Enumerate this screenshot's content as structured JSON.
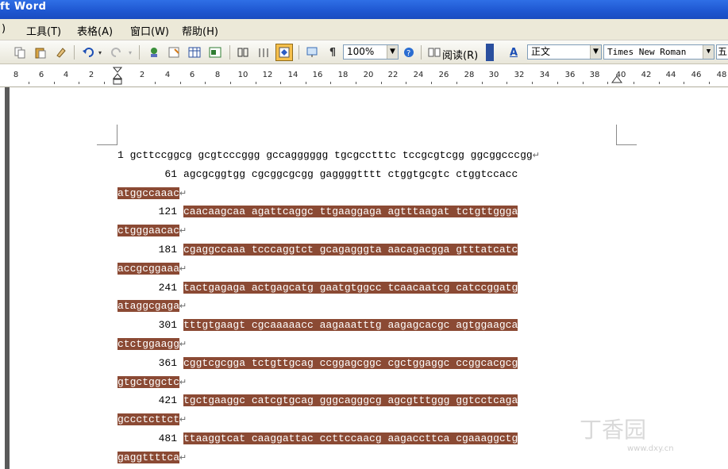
{
  "window": {
    "title": "ft Word"
  },
  "menu": [
    {
      "key": "partial",
      "label": ")"
    },
    {
      "key": "tools",
      "label": "工具(T)"
    },
    {
      "key": "table",
      "label": "表格(A)"
    },
    {
      "key": "window",
      "label": "窗口(W)"
    },
    {
      "key": "help",
      "label": "帮助(H)"
    }
  ],
  "toolbar": {
    "zoom": "100%",
    "read_label": "阅读(R)",
    "style": "正文",
    "font": "Times New Roman",
    "size_partial": "五",
    "icons": [
      "copy-icon",
      "paste-icon",
      "format-painter-icon",
      "undo-icon",
      "redo-icon",
      "hyperlink-icon",
      "tables-borders-icon",
      "insert-table-icon",
      "insert-excel-icon",
      "columns-icon",
      "drawing-icon",
      "document-map-icon",
      "show-hide-icon",
      "help-icon",
      "read-icon",
      "styles-icon"
    ]
  },
  "ruler": {
    "labels": [
      "8",
      "6",
      "4",
      "2",
      "2",
      "4",
      "6",
      "8",
      "10",
      "12",
      "14",
      "16",
      "18",
      "20",
      "22",
      "24",
      "26",
      "28",
      "30",
      "32",
      "34",
      "36",
      "38",
      "40",
      "42",
      "44",
      "46",
      "48"
    ]
  },
  "document": {
    "lines": [
      {
        "text": "1 gcttccggcg gcgtcccggg gccagggggg tgcgcctttc tccgcgtcgg ggcggcccgg",
        "pilcrow": "↵",
        "highlight": false
      },
      {
        "prefix": "61",
        "text": "agcgcggtgg cgcggcgcgg gaggggtttt ctggtgcgtc ctggtccacc",
        "pilcrow": "",
        "highlight": false
      },
      {
        "text": "atggccaaac",
        "pilcrow": "↵",
        "highlight": true
      },
      {
        "prefix": "121",
        "text": "caacaagcaa agattcaggc ttgaaggaga agtttaagat tctgttggga",
        "pilcrow": "",
        "highlight": true
      },
      {
        "text": "ctgggaacac",
        "pilcrow": "↵",
        "highlight": true
      },
      {
        "prefix": "181",
        "text": "cgaggccaaa tcccaggtct gcagagggta aacagacgga gtttatcatc",
        "pilcrow": "",
        "highlight": true
      },
      {
        "text": "accgcggaaa",
        "pilcrow": "↵",
        "highlight": true
      },
      {
        "prefix": "241",
        "text": "tactgagaga actgagcatg gaatgtggcc tcaacaatcg catccggatg",
        "pilcrow": "",
        "highlight": true
      },
      {
        "text": "ataggcgaga",
        "pilcrow": "↵",
        "highlight": true
      },
      {
        "prefix": "301",
        "text": "tttgtgaagt cgcaaaaacc aagaaatttg aagagcacgc agtggaagca",
        "pilcrow": "",
        "highlight": true
      },
      {
        "text": "ctctggaagg",
        "pilcrow": "↵",
        "highlight": true
      },
      {
        "prefix": "361",
        "text": "cggtcgcgga tctgttgcag ccggagcggc cgctggaggc ccggcacgcg",
        "pilcrow": "",
        "highlight": true
      },
      {
        "text": "gtgctggctc",
        "pilcrow": "↵",
        "highlight": true
      },
      {
        "prefix": "421",
        "text": "tgctgaaggc catcgtgcag gggcagggcg agcgtttggg ggtcctcaga",
        "pilcrow": "",
        "highlight": true
      },
      {
        "text": "gccctcttct",
        "pilcrow": "↵",
        "highlight": true
      },
      {
        "prefix": "481",
        "text": "ttaaggtcat caaggattac ccttccaacg aagaccttca cgaaaggctg",
        "pilcrow": "",
        "highlight": true
      },
      {
        "text": "gaggttttca",
        "pilcrow": "↵",
        "highlight": true
      }
    ]
  },
  "watermark": {
    "text": "丁香园",
    "sub": "www.dxy.cn"
  }
}
